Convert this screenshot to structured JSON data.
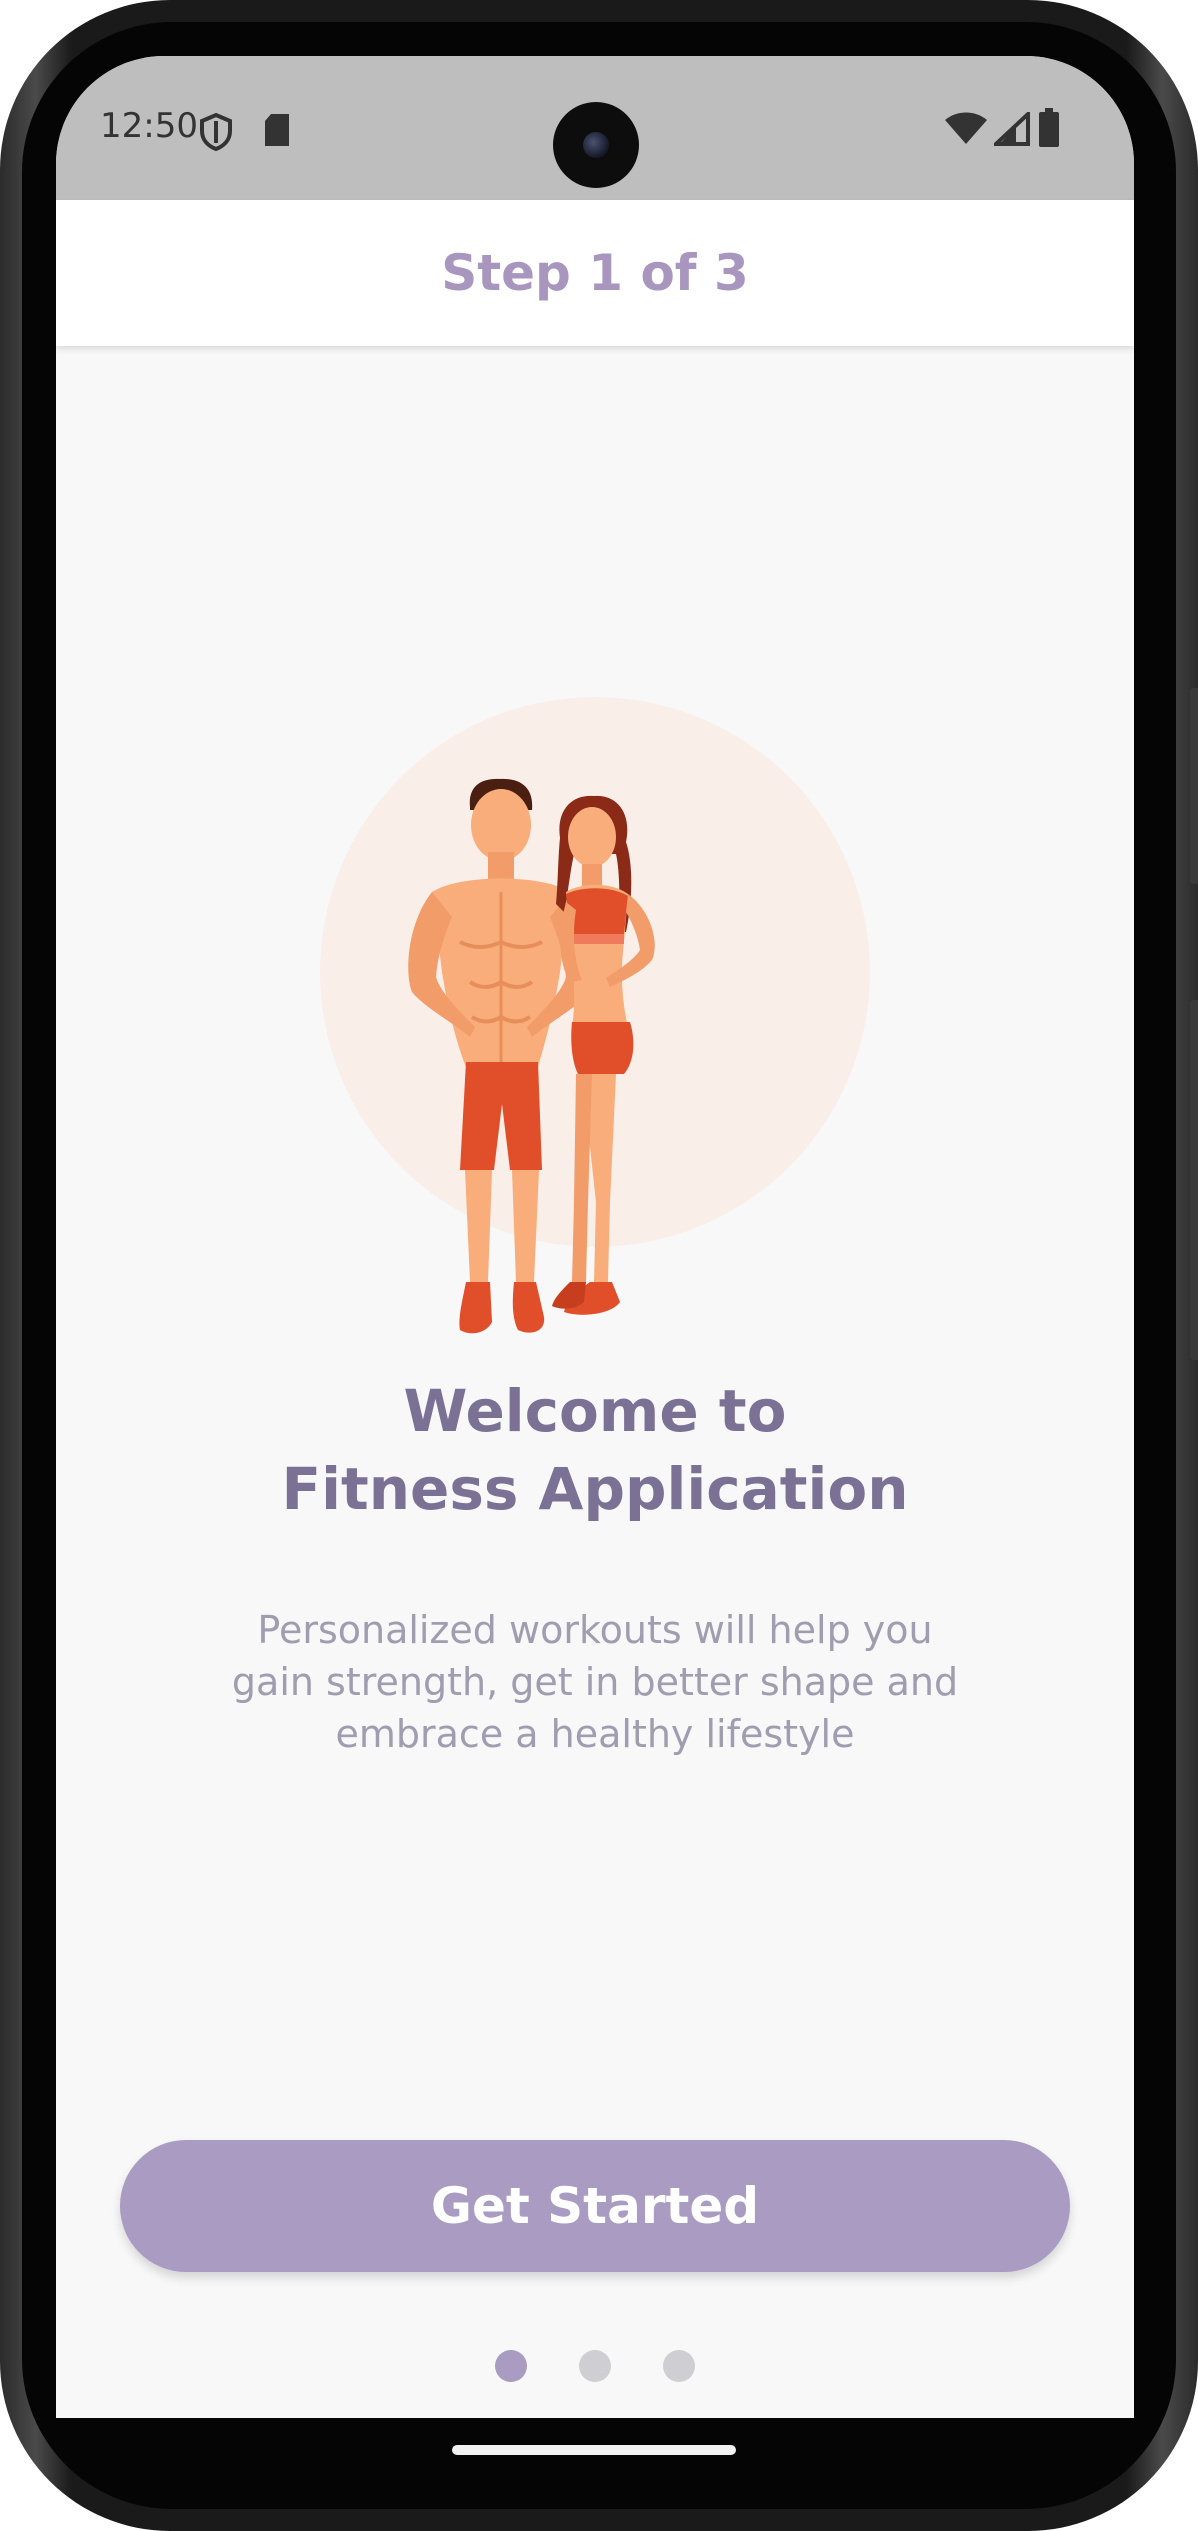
{
  "status_bar": {
    "time": "12:50",
    "left_icons": [
      "shield-icon",
      "sd-card-icon"
    ],
    "right_icons": [
      "wifi-icon",
      "signal-icon",
      "battery-icon"
    ]
  },
  "app_bar": {
    "title": "Step 1 of 3"
  },
  "hero": {
    "illustration": "fitness-couple-illustration"
  },
  "content": {
    "headline_line1": "Welcome to",
    "headline_line2": "Fitness Application",
    "description_line1": "Personalized workouts will help you",
    "description_line2": "gain strength, get in better shape and",
    "description_line3": "embrace a healthy lifestyle"
  },
  "cta": {
    "label": "Get Started"
  },
  "pager": {
    "total": 3,
    "active_index": 0
  },
  "colors": {
    "accent": "#a99bc1",
    "headline": "#7a7194",
    "body_text": "#a19db0",
    "hero_circle": "#faeee9",
    "figure_skin": "#f9ad7a",
    "figure_clothes": "#e14e2a"
  }
}
